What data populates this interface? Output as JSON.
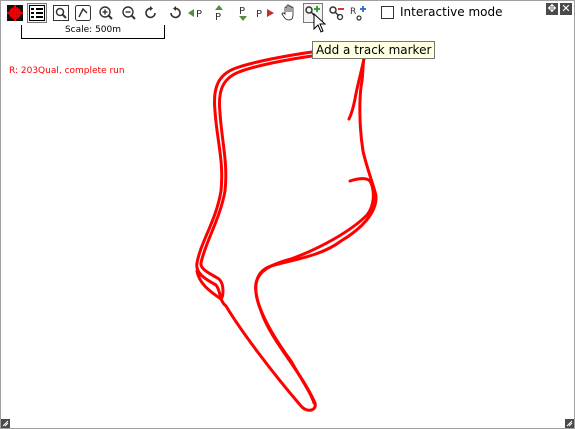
{
  "toolbar": {
    "buttons": [
      {
        "icon": "red-gear-icon",
        "label": ""
      },
      {
        "icon": "checklist-icon",
        "label": ""
      },
      {
        "icon": "zoom-box-icon",
        "label": ""
      },
      {
        "icon": "draw-track-icon",
        "label": ""
      },
      {
        "icon": "zoom-in-icon",
        "label": ""
      },
      {
        "icon": "zoom-out-icon",
        "label": ""
      },
      {
        "icon": "rotate-icon",
        "label": ""
      },
      {
        "icon": "rotate-back-icon",
        "label": ""
      },
      {
        "icon": "previous-marker-icon",
        "label": ""
      },
      {
        "icon": "marker-up-icon",
        "label": ""
      },
      {
        "icon": "marker-down-icon",
        "label": ""
      },
      {
        "icon": "next-marker-icon",
        "label": ""
      },
      {
        "icon": "pan-hand-icon",
        "label": ""
      },
      {
        "icon": "add-track-marker-icon",
        "label": ""
      },
      {
        "icon": "remove-track-marker-icon",
        "label": ""
      },
      {
        "icon": "reset-markers-icon",
        "label": ""
      }
    ],
    "interactive_mode": {
      "label": "Interactive mode",
      "checked": false
    }
  },
  "scale": {
    "label": "Scale: 500m"
  },
  "run_label": "R:  203Qual, complete run",
  "tooltip": "Add a track marker",
  "track_color": "#ff0000"
}
